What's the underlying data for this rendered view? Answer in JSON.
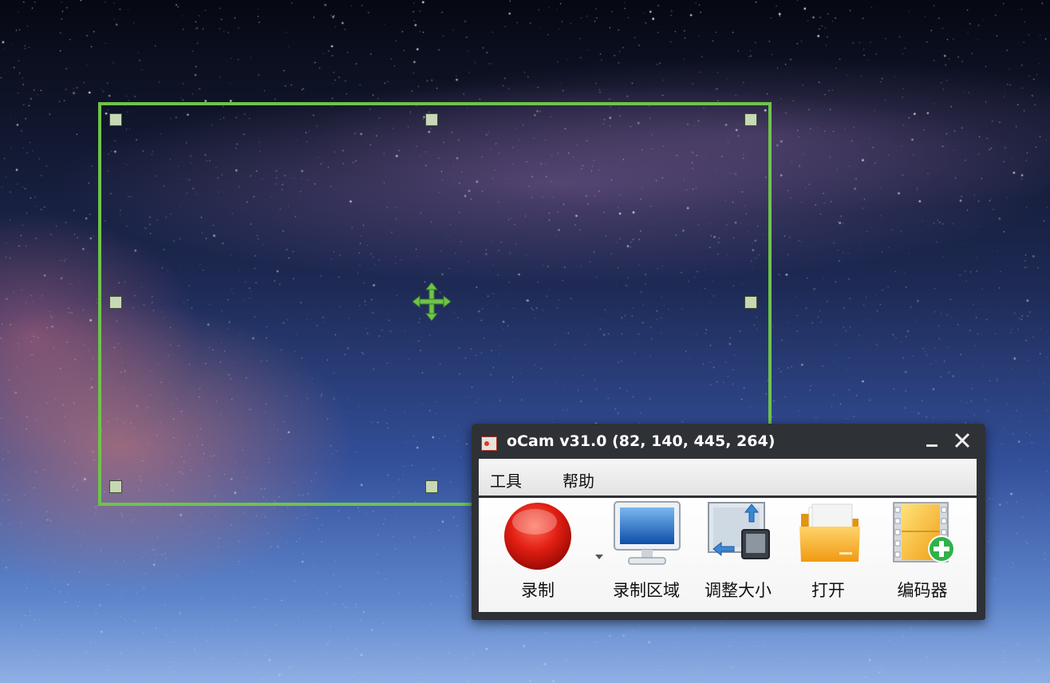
{
  "window": {
    "title": "oCam v31.0 (82, 140, 445, 264)",
    "minimize_icon": "minimize-icon",
    "close_icon": "close-icon"
  },
  "menu": [
    {
      "label": "工具"
    },
    {
      "label": "帮助"
    }
  ],
  "toolbar": [
    {
      "label": "录制",
      "icon": "record-icon"
    },
    {
      "label": "录制区域",
      "icon": "monitor-icon"
    },
    {
      "label": "调整大小",
      "icon": "resize-icon"
    },
    {
      "label": "打开",
      "icon": "folder-icon"
    },
    {
      "label": "编码器",
      "icon": "film-add-icon"
    }
  ],
  "selection": {
    "frame_color": "#6fc34a",
    "handle_color": "#c7d8b4"
  }
}
